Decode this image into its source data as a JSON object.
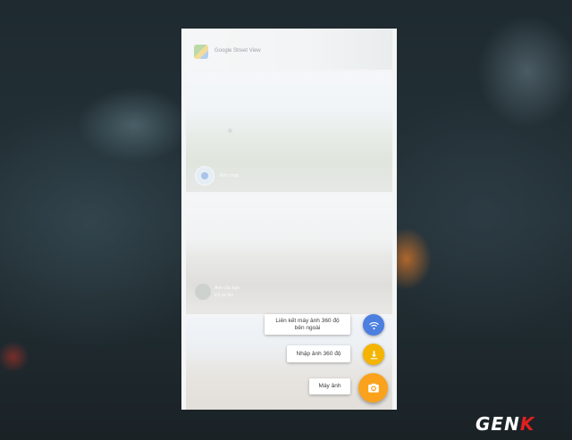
{
  "cards": [
    {
      "title": "Google Street View"
    },
    {
      "caption": "Ảnh chụp"
    },
    {
      "caption_a": "Ảnh của bạn",
      "caption_b": "Đã tải lên"
    }
  ],
  "fab_menu": {
    "link_camera_line1": "Liên kết máy ảnh 360 độ",
    "link_camera_line2": "bên ngoài",
    "import_360": "Nhập ảnh 360 độ",
    "camera": "Máy ảnh"
  },
  "icons": {
    "link": "wifi-icon",
    "import": "download-icon",
    "camera": "camera-icon"
  },
  "colors": {
    "blue_fab": "#4b7fe0",
    "yellow_fab": "#f4b400",
    "orange_fab": "#fba21c"
  },
  "watermark": {
    "part1": "GEN",
    "part2": "K"
  }
}
